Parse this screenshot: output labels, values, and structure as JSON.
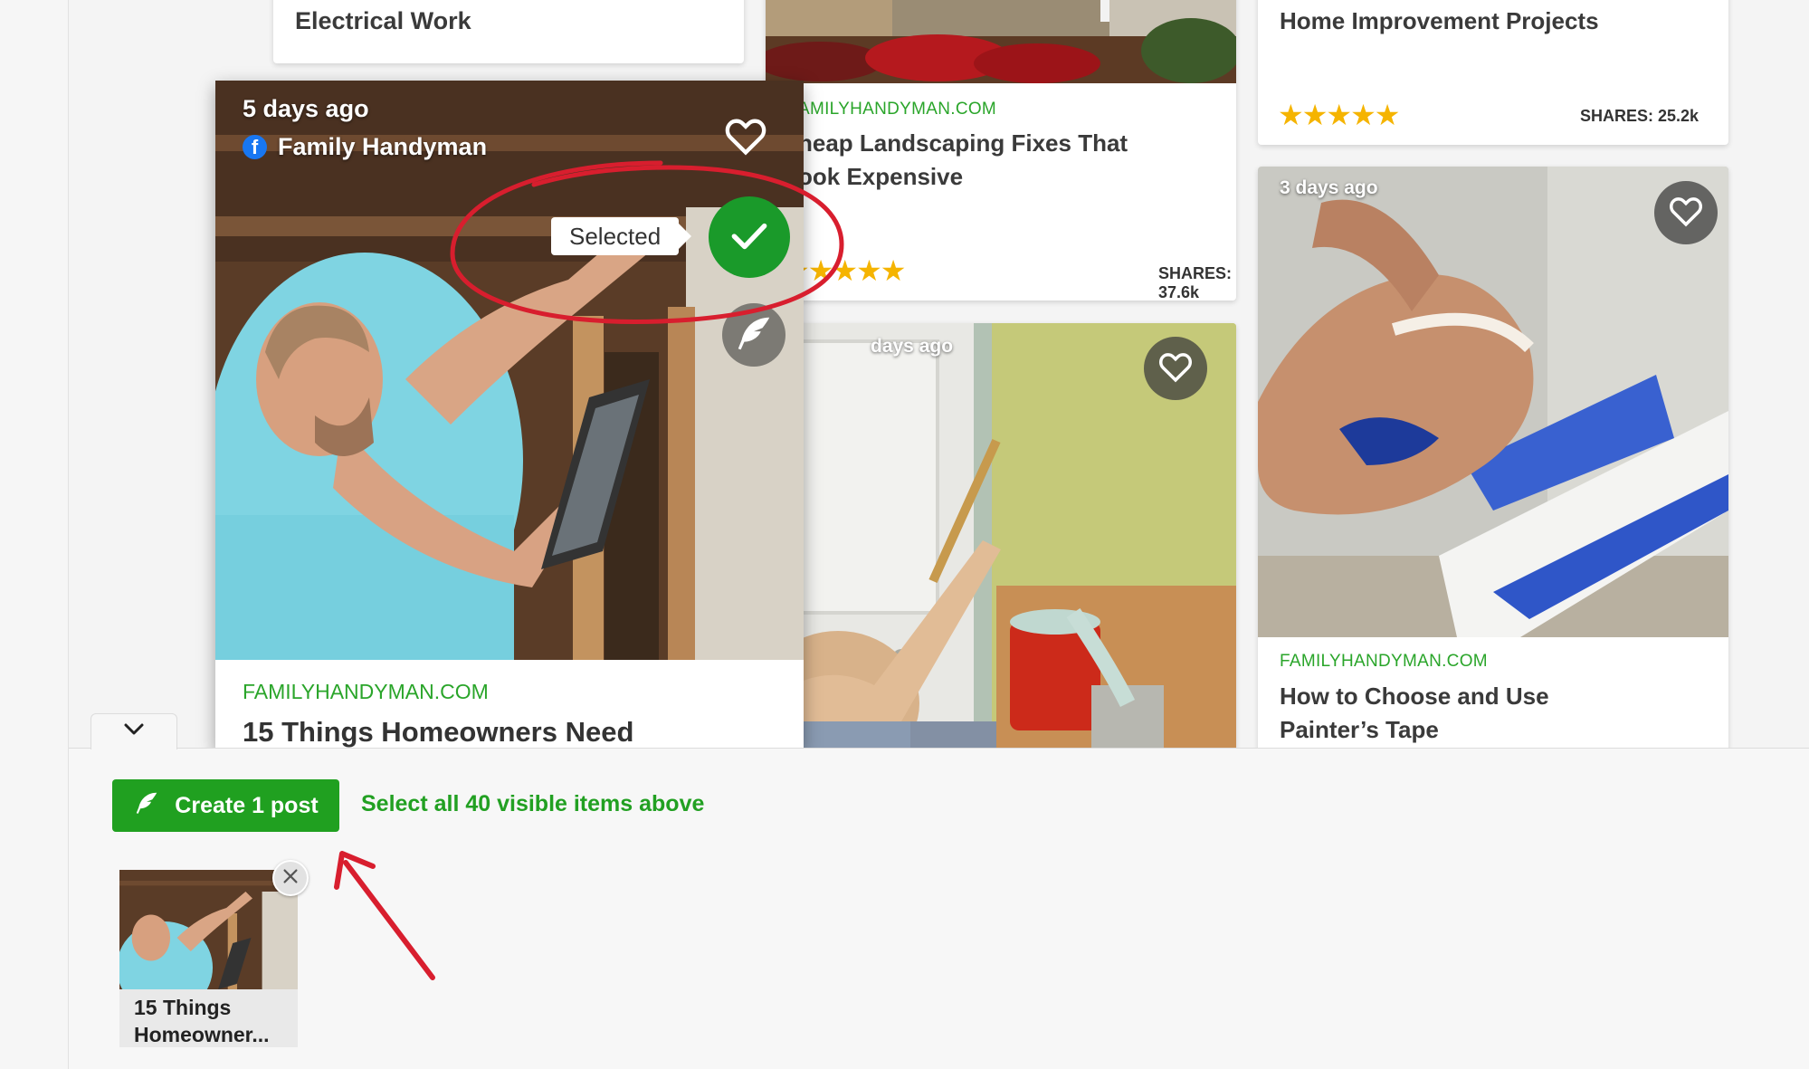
{
  "feed": {
    "card_top_left": {
      "title": "Electrical Work"
    },
    "card_top_mid": {
      "source": "AMILYHANDYMAN.COM",
      "title_line1": "heap Landscaping Fixes That",
      "title_line2": "ook Expensive",
      "stars": "★★★★★",
      "shares": "SHARES: 37.6k"
    },
    "card_top_right": {
      "title": "Home Improvement Projects",
      "stars": "★★★★★",
      "shares": "SHARES: 25.2k"
    },
    "card_mid": {
      "ago": "days ago"
    },
    "card_right": {
      "ago": "3 days ago",
      "source": "FAMILYHANDYMAN.COM",
      "title_line1": "How to Choose and Use",
      "title_line2": "Painter’s Tape"
    }
  },
  "featured": {
    "ago": "5 days ago",
    "publisher": "Family Handyman",
    "selected_label": "Selected",
    "source": "FAMILYHANDYMAN.COM",
    "title": "15 Things Homeowners Need"
  },
  "bottom_bar": {
    "create_label": "Create 1 post",
    "select_all_label": "Select all 40 visible items above",
    "thumb_caption_line1": "15 Things",
    "thumb_caption_line2": "Homeowner..."
  },
  "icons": {
    "collapse": "chevron-down-icon",
    "facebook": "facebook-icon",
    "heart": "heart-icon",
    "check": "check-icon",
    "quill": "quill-icon",
    "close": "close-icon"
  },
  "colors": {
    "accent_green": "#20a020",
    "source_green": "#2aa52a",
    "star_gold": "#f5b400",
    "annotation_red": "#d81e2e",
    "facebook_blue": "#1877f2"
  }
}
